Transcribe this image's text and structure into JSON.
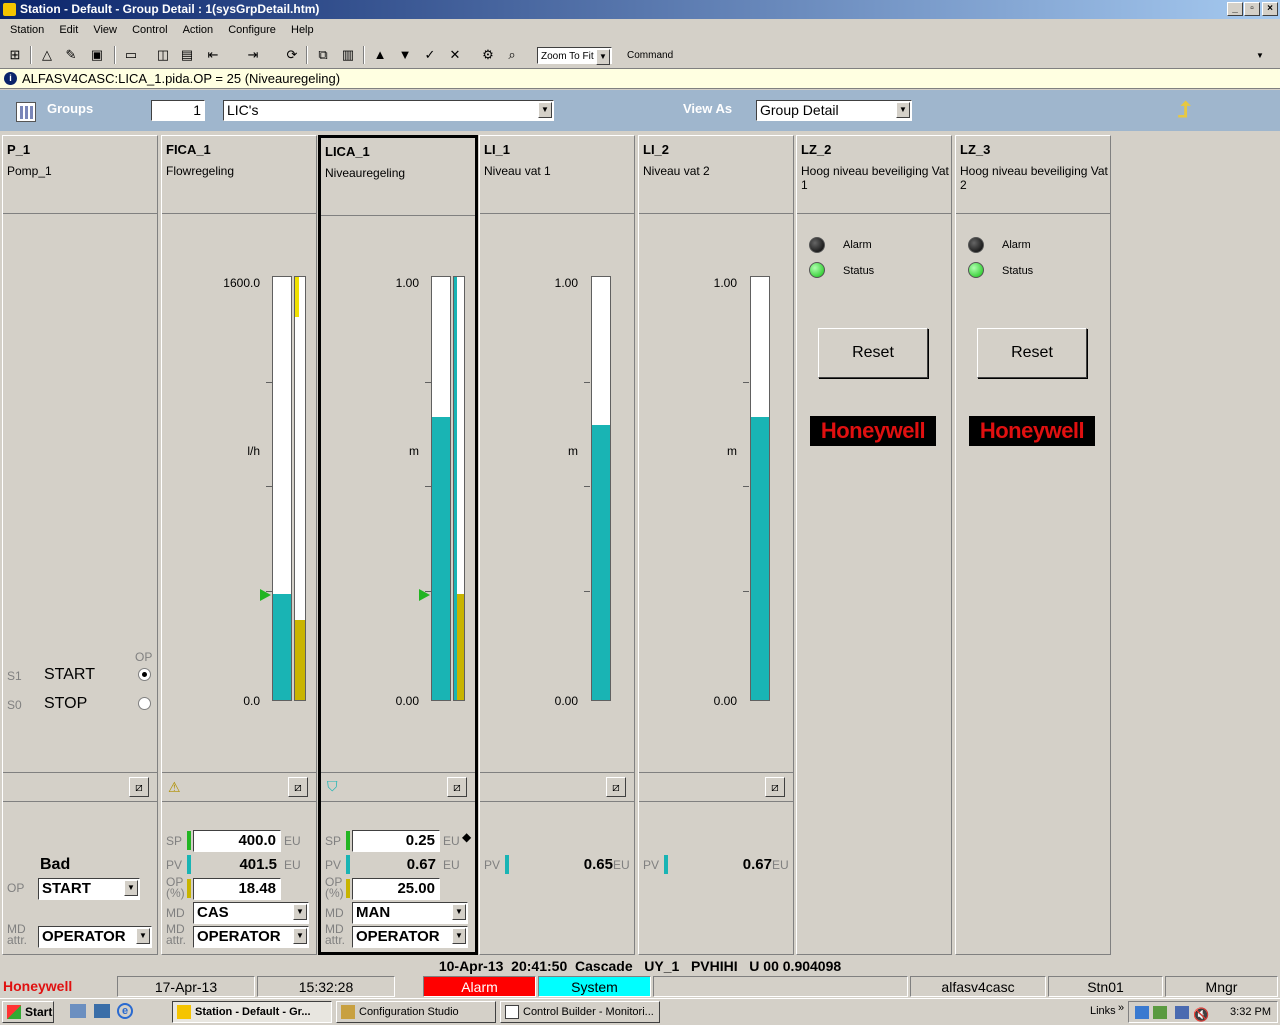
{
  "window": {
    "title": "Station - Default - Group Detail : 1(sysGrpDetail.htm)",
    "btn_min": "_",
    "btn_max": "▫",
    "btn_close": "×"
  },
  "menu": [
    "Station",
    "Edit",
    "View",
    "Control",
    "Action",
    "Configure",
    "Help"
  ],
  "toolbar": {
    "zoom": "Zoom To Fit",
    "command_label": "Command",
    "command_value": ""
  },
  "message": "ALFASV4CASC:LICA_1.pida.OP = 25 (Niveauregeling)",
  "groupbar": {
    "groups_label": "Groups",
    "group_number": "1",
    "group_name": "LIC's",
    "viewas_label": "View As",
    "view_value": "Group Detail",
    "up_icon": "up-arrow-icon"
  },
  "colors": {
    "pv_fill": "#19b4b4",
    "op_fill": "#c8b400",
    "sp_ptr": "#22b522",
    "alarm_bg": "#ff0000",
    "system_bg": "#00ffff",
    "brand": "#e01010"
  },
  "columns": {
    "p1": {
      "tag": "P_1",
      "desc": "Pomp_1",
      "op_header": "OP",
      "s1": "S1",
      "start": "START",
      "s0": "S0",
      "stop": "STOP",
      "bad": "Bad",
      "op_label": "OP",
      "op_value": "START",
      "md_label": "MD attr.",
      "md_value": "OPERATOR"
    },
    "fica1": {
      "tag": "FICA_1",
      "desc": "Flowregeling",
      "max": "1600.0",
      "min": "0.0",
      "unit": "l/h",
      "pv_frac": 0.25,
      "sp_frac": 0.25,
      "op_frac": 0.19,
      "out_frac": 0.96,
      "sp_label": "SP",
      "sp": "400.0",
      "pv_label": "PV",
      "pv": "401.5",
      "op_label": "OP (%)",
      "op": "18.48",
      "eu": "EU",
      "md_label": "MD",
      "md": "CAS",
      "mda_label": "MD attr.",
      "mda": "OPERATOR"
    },
    "lica1": {
      "tag": "LICA_1",
      "desc": "Niveauregeling",
      "max": "1.00",
      "min": "0.00",
      "unit": "m",
      "pv_frac": 0.67,
      "sp_frac": 0.25,
      "op_frac": 0.25,
      "sp_label": "SP",
      "sp": "0.25",
      "pv_label": "PV",
      "pv": "0.67",
      "op_label": "OP (%)",
      "op": "25.00",
      "eu": "EU",
      "md_label": "MD",
      "md": "MAN",
      "mda_label": "MD attr.",
      "mda": "OPERATOR"
    },
    "li1": {
      "tag": "LI_1",
      "desc": "Niveau vat 1",
      "max": "1.00",
      "min": "0.00",
      "unit": "m",
      "pv_frac": 0.65,
      "pv_label": "PV",
      "pv": "0.65",
      "eu": "EU"
    },
    "li2": {
      "tag": "LI_2",
      "desc": "Niveau vat 2",
      "max": "1.00",
      "min": "0.00",
      "unit": "m",
      "pv_frac": 0.67,
      "pv_label": "PV",
      "pv": "0.67",
      "eu": "EU"
    },
    "lz2": {
      "tag": "LZ_2",
      "desc": "Hoog niveau beveiliging Vat 1",
      "alarm": "Alarm",
      "status": "Status",
      "reset": "Reset",
      "logo": "Honeywell"
    },
    "lz3": {
      "tag": "LZ_3",
      "desc": "Hoog niveau beveiliging Vat 2",
      "alarm": "Alarm",
      "status": "Status",
      "reset": "Reset",
      "logo": "Honeywell"
    }
  },
  "event": "10-Apr-13  20:41:50  Cascade   UY_1   PVHIHI   U 00 0.904098",
  "status": {
    "brand": "Honeywell",
    "date": "17-Apr-13",
    "time": "15:32:28",
    "alarm": "Alarm",
    "system": "System",
    "server": "alfasv4casc",
    "station": "Stn01",
    "level": "Mngr"
  },
  "taskbar": {
    "start": "Start",
    "items": [
      "Station - Default - Gr...",
      "Configuration Studio",
      "Control Builder - Monitori..."
    ],
    "links": "Links",
    "clock": "3:32 PM"
  }
}
